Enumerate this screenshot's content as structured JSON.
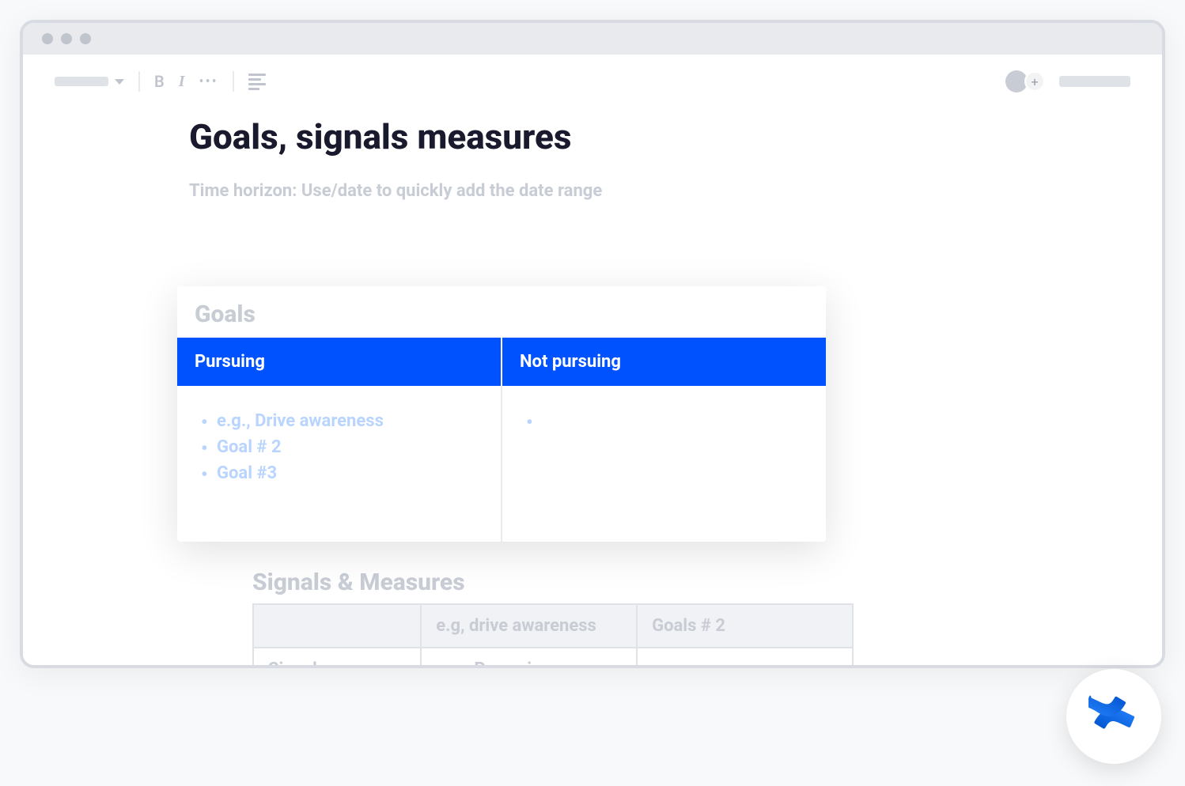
{
  "toolbar": {
    "bold": "B",
    "italic": "I",
    "more": "•••",
    "add": "+"
  },
  "page": {
    "title": "Goals, signals measures",
    "time_horizon": "Time horizon: Use/date to quickly add the date range"
  },
  "goals_card": {
    "heading": "Goals",
    "col_pursuing": "Pursuing",
    "col_not_pursuing": "Not pursuing",
    "pursuing_items": [
      "e.g., Drive awareness",
      "Goal # 2",
      "Goal #3"
    ]
  },
  "signals": {
    "heading": "Signals & Measures",
    "header_col2": "e.g, drive awareness",
    "header_col3": "Goals # 2",
    "row1_col1": "Signals: Brainstorming",
    "row1_col2": "e.g., Page views"
  }
}
